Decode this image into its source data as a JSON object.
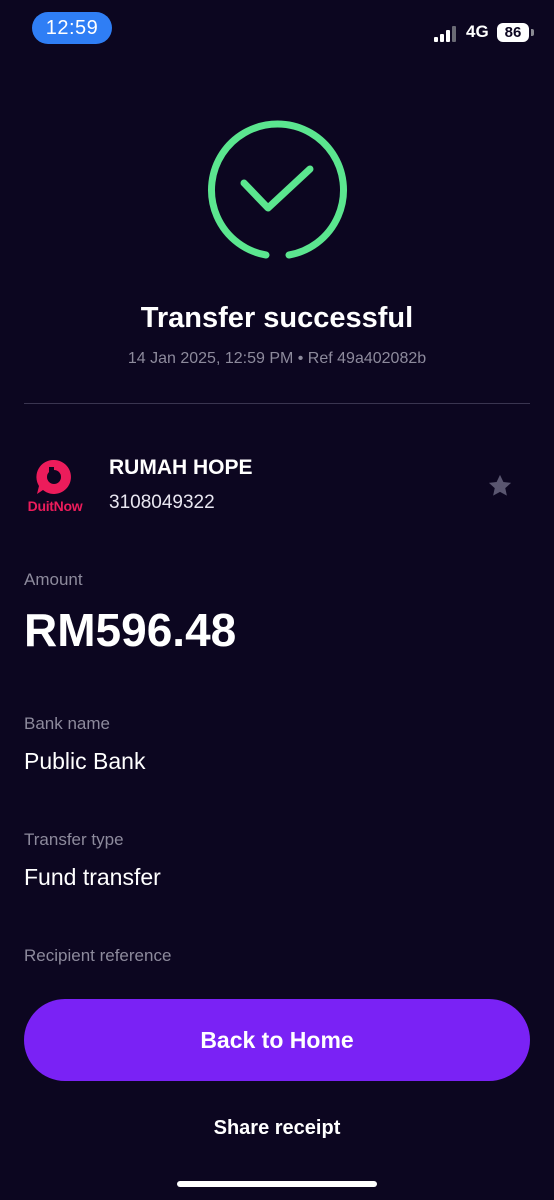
{
  "status_bar": {
    "time": "12:59",
    "network": "4G",
    "battery": "86"
  },
  "receipt": {
    "title": "Transfer successful",
    "meta": "14 Jan 2025, 12:59 PM • Ref 49a402082b",
    "status_color": "#5be68f"
  },
  "recipient": {
    "logo_text": "DuitNow",
    "name": "RUMAH HOPE",
    "account": "3108049322",
    "favorite_icon": "star-icon"
  },
  "details": {
    "amount_label": "Amount",
    "amount_value": "RM596.48",
    "bank_label": "Bank name",
    "bank_value": "Public Bank",
    "type_label": "Transfer type",
    "type_value": "Fund transfer",
    "reference_label": "Recipient reference"
  },
  "actions": {
    "back_label": "Back to Home",
    "share_label": "Share receipt",
    "primary_color": "#7a22f5"
  }
}
